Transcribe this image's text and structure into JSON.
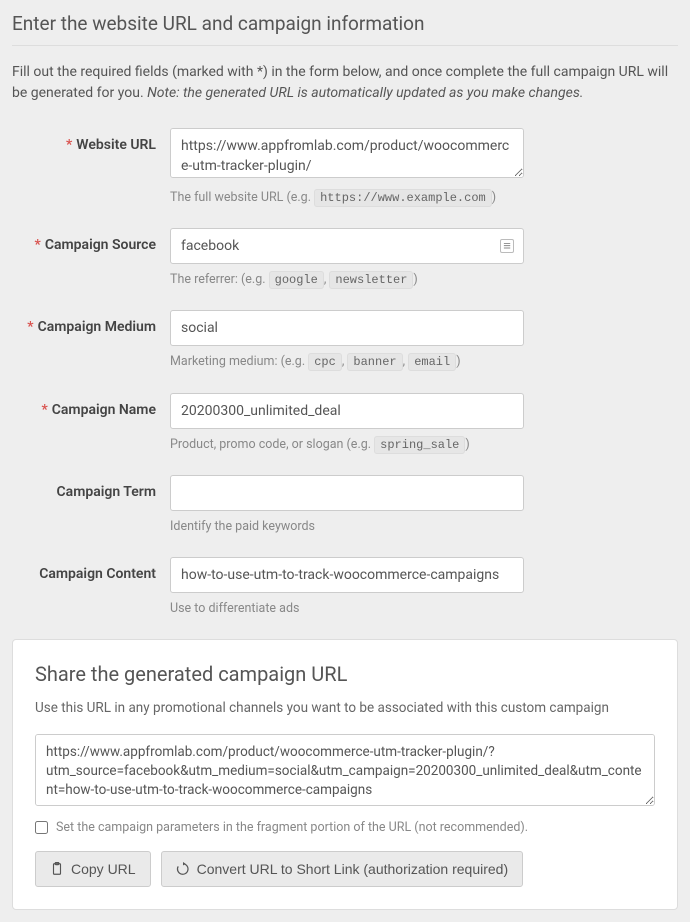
{
  "header": {
    "title": "Enter the website URL and campaign information",
    "intro_text": "Fill out the required fields (marked with *) in the form below, and once complete the full campaign URL will be generated for you. ",
    "intro_note": "Note: the generated URL is automatically updated as you make changes."
  },
  "fields": {
    "url": {
      "label": "Website URL",
      "value": "https://www.appfromlab.com/product/woocommerce-utm-tracker-plugin/",
      "hint_prefix": "The full website URL (e.g. ",
      "hint_code": "https://www.example.com",
      "hint_suffix": ")"
    },
    "source": {
      "label": "Campaign Source",
      "value": "facebook",
      "hint_prefix": "The referrer: (e.g. ",
      "hint_code1": "google",
      "hint_sep": ", ",
      "hint_code2": "newsletter",
      "hint_suffix": ")"
    },
    "medium": {
      "label": "Campaign Medium",
      "value": "social",
      "hint_prefix": "Marketing medium: (e.g. ",
      "hint_code1": "cpc",
      "hint_sep1": ", ",
      "hint_code2": "banner",
      "hint_sep2": ", ",
      "hint_code3": "email",
      "hint_suffix": ")"
    },
    "name": {
      "label": "Campaign Name",
      "value": "20200300_unlimited_deal",
      "hint_prefix": "Product, promo code, or slogan (e.g. ",
      "hint_code": "spring_sale",
      "hint_suffix": ")"
    },
    "term": {
      "label": "Campaign Term",
      "value": "",
      "hint": "Identify the paid keywords"
    },
    "content": {
      "label": "Campaign Content",
      "value": "how-to-use-utm-to-track-woocommerce-campaigns",
      "hint": "Use to differentiate ads"
    }
  },
  "share": {
    "title": "Share the generated campaign URL",
    "subtitle": "Use this URL in any promotional channels you want to be associated with this custom campaign",
    "generated": "https://www.appfromlab.com/product/woocommerce-utm-tracker-plugin/?utm_source=facebook&utm_medium=social&utm_campaign=20200300_unlimited_deal&utm_content=how-to-use-utm-to-track-woocommerce-campaigns",
    "fragment_label": "Set the campaign parameters in the fragment portion of the URL (not recommended).",
    "copy_btn": "Copy URL",
    "convert_btn": "Convert URL to Short Link (authorization required)"
  }
}
